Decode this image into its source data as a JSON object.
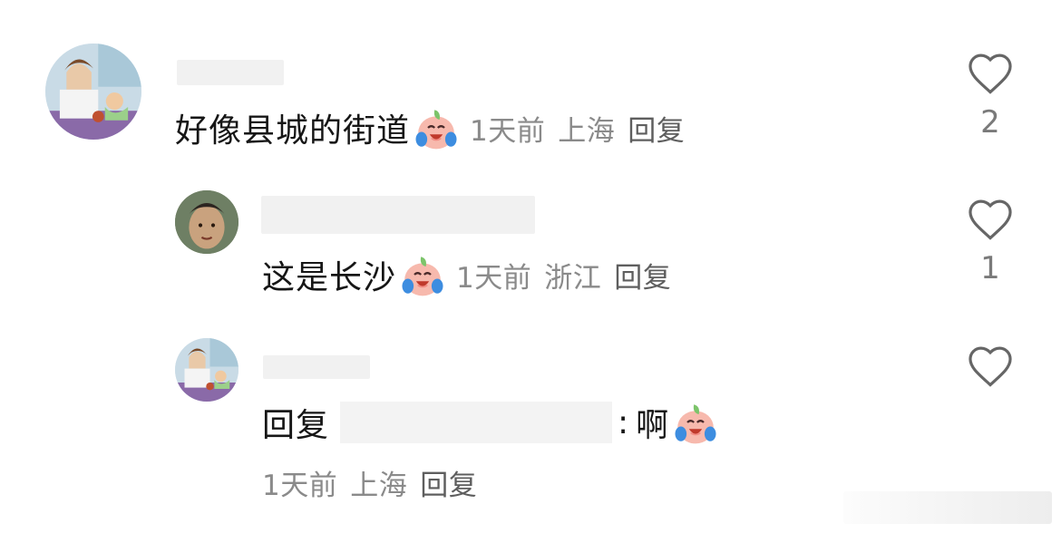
{
  "comments": [
    {
      "text": "好像县城的街道",
      "time": "1天前",
      "location": "上海",
      "reply_label": "回复",
      "likes": "2",
      "emoji": "laughing-tears-peach"
    },
    {
      "text": "这是长沙",
      "time": "1天前",
      "location": "浙江",
      "reply_label": "回复",
      "likes": "1",
      "emoji": "laughing-tears-peach"
    },
    {
      "prefix": "回复",
      "colon": ":",
      "text": "啊",
      "time": "1天前",
      "location": "上海",
      "reply_label": "回复",
      "emoji": "laughing-tears-peach"
    }
  ],
  "icons": {
    "like": "heart-outline-icon",
    "emoji": "laughing-tears-peach-icon"
  },
  "colors": {
    "text": "#161616",
    "meta": "#8a8a8a",
    "icon": "#666666"
  }
}
